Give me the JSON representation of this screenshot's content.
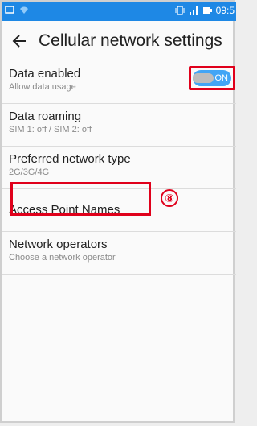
{
  "status": {
    "time": "09:5",
    "icons_left": [
      "screen-icon",
      "wifi-icon"
    ],
    "icons_right": [
      "vibrate-icon",
      "signal-icon",
      "battery-icon"
    ]
  },
  "toolbar": {
    "title": "Cellular network settings",
    "back_icon": "arrow-back-icon"
  },
  "settings": [
    {
      "title": "Data enabled",
      "subtitle": "Allow data usage",
      "toggle": "ON"
    },
    {
      "title": "Data roaming",
      "subtitle": "SIM 1: off / SIM 2: off"
    },
    {
      "title": "Preferred network type",
      "subtitle": "2G/3G/4G"
    },
    {
      "title": "Access Point Names"
    },
    {
      "title": "Network operators",
      "subtitle": "Choose a network operator"
    }
  ],
  "annotation": {
    "label": "⑧",
    "color": "#e0001b"
  },
  "colors": {
    "accent": "#1e88e5",
    "toggle": "#42a5f5",
    "highlight": "#e0001b"
  }
}
